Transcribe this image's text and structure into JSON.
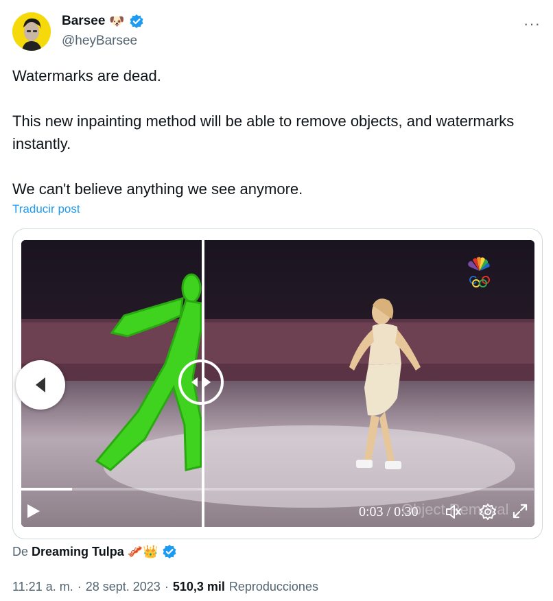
{
  "author": {
    "name": "Barsee",
    "name_emoji": "🐶",
    "handle": "@heyBarsee",
    "verified": true
  },
  "more_menu_label": "···",
  "tweet": {
    "line1": "Watermarks are dead.",
    "line2": "This new inpainting method will be able to remove objects, and watermarks instantly.",
    "line3": "We can't believe anything we see anymore."
  },
  "translate_label": "Traducir post",
  "video": {
    "current_time": "0:03",
    "separator": "/",
    "duration": "0:30",
    "progress_fraction": 0.1,
    "watermark_text": "Object Removal"
  },
  "source": {
    "prefix": "De",
    "name": "Dreaming Tulpa",
    "emojis": "🥓👑",
    "verified": true
  },
  "meta": {
    "time": "11:21 a. m.",
    "dot1": "·",
    "date": "28 sept. 2023",
    "dot2": "·",
    "views": "510,3 mil",
    "views_label": "Reproducciones"
  },
  "colors": {
    "accent": "#1d9bf0",
    "secondary_text": "#536471",
    "green_overlay": "#3fd21f"
  }
}
